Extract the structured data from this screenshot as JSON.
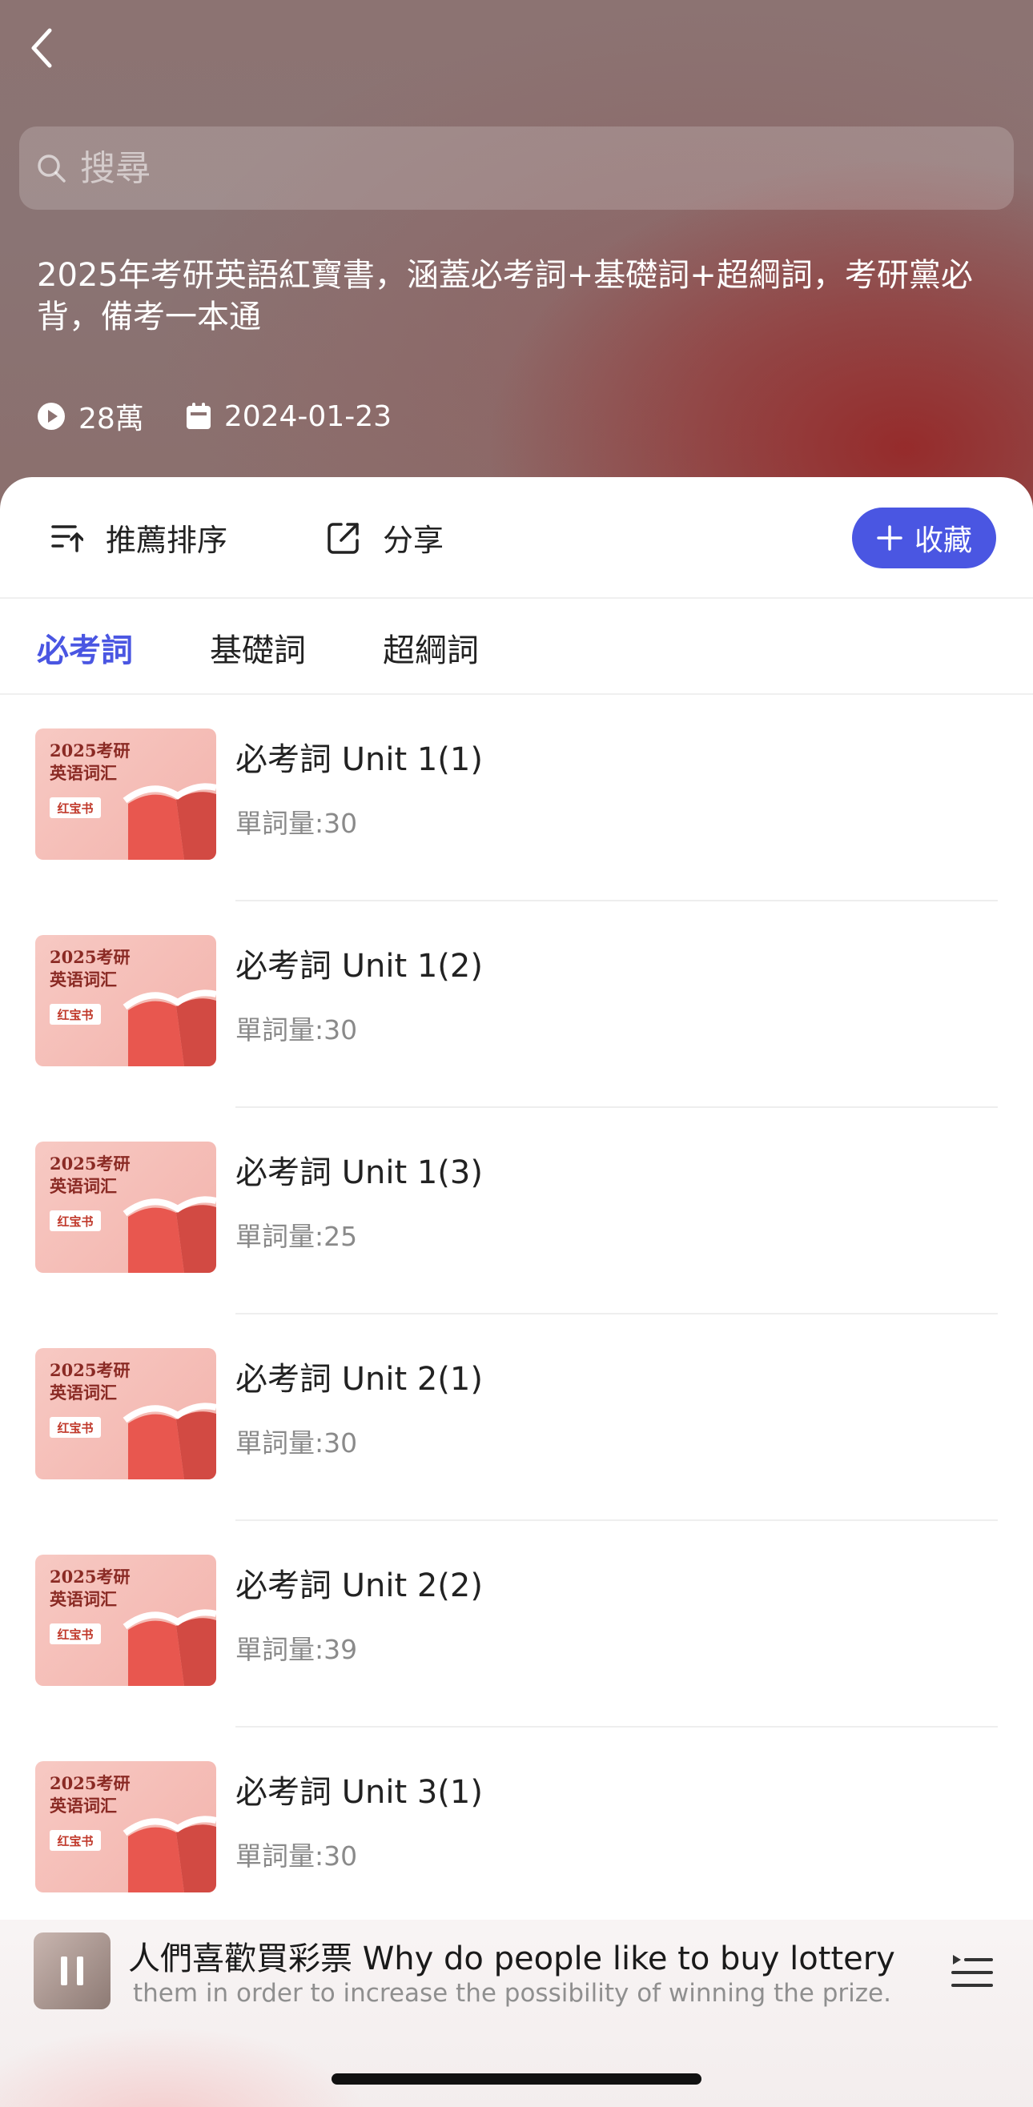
{
  "header": {
    "back_icon": "chevron-left-icon",
    "search_placeholder": "搜尋",
    "description": "2025年考研英語紅寶書，涵蓋必考詞+基礎詞+超綱詞，考研黨必背，備考一本通",
    "plays": "28萬",
    "date": "2024-01-23"
  },
  "toolbar": {
    "sort_label": "推薦排序",
    "share_label": "分享",
    "collect_label": "收藏"
  },
  "tabs": [
    {
      "label": "必考詞",
      "active": true
    },
    {
      "label": "基礎詞",
      "active": false
    },
    {
      "label": "超綱詞",
      "active": false
    }
  ],
  "thumb": {
    "line1": "2025考研",
    "line2": "英语词汇",
    "badge": "红宝书"
  },
  "items": [
    {
      "title": "必考詞 Unit 1(1)",
      "count": "單詞量:30"
    },
    {
      "title": "必考詞 Unit 1(2)",
      "count": "單詞量:30"
    },
    {
      "title": "必考詞 Unit 1(3)",
      "count": "單詞量:25"
    },
    {
      "title": "必考詞 Unit 2(1)",
      "count": "單詞量:30"
    },
    {
      "title": "必考詞 Unit 2(2)",
      "count": "單詞量:39"
    },
    {
      "title": "必考詞 Unit 3(1)",
      "count": "單詞量:30"
    }
  ],
  "player": {
    "title": "人們喜歡買彩票 Why do people like to buy lottery",
    "subtitle": "them in order to increase the possibility of winning the prize.",
    "state_icon": "pause-icon",
    "playlist_icon": "playlist-icon"
  },
  "colors": {
    "accent": "#4a56e2",
    "hero_base": "#8c7372",
    "hero_glow": "#962828"
  }
}
